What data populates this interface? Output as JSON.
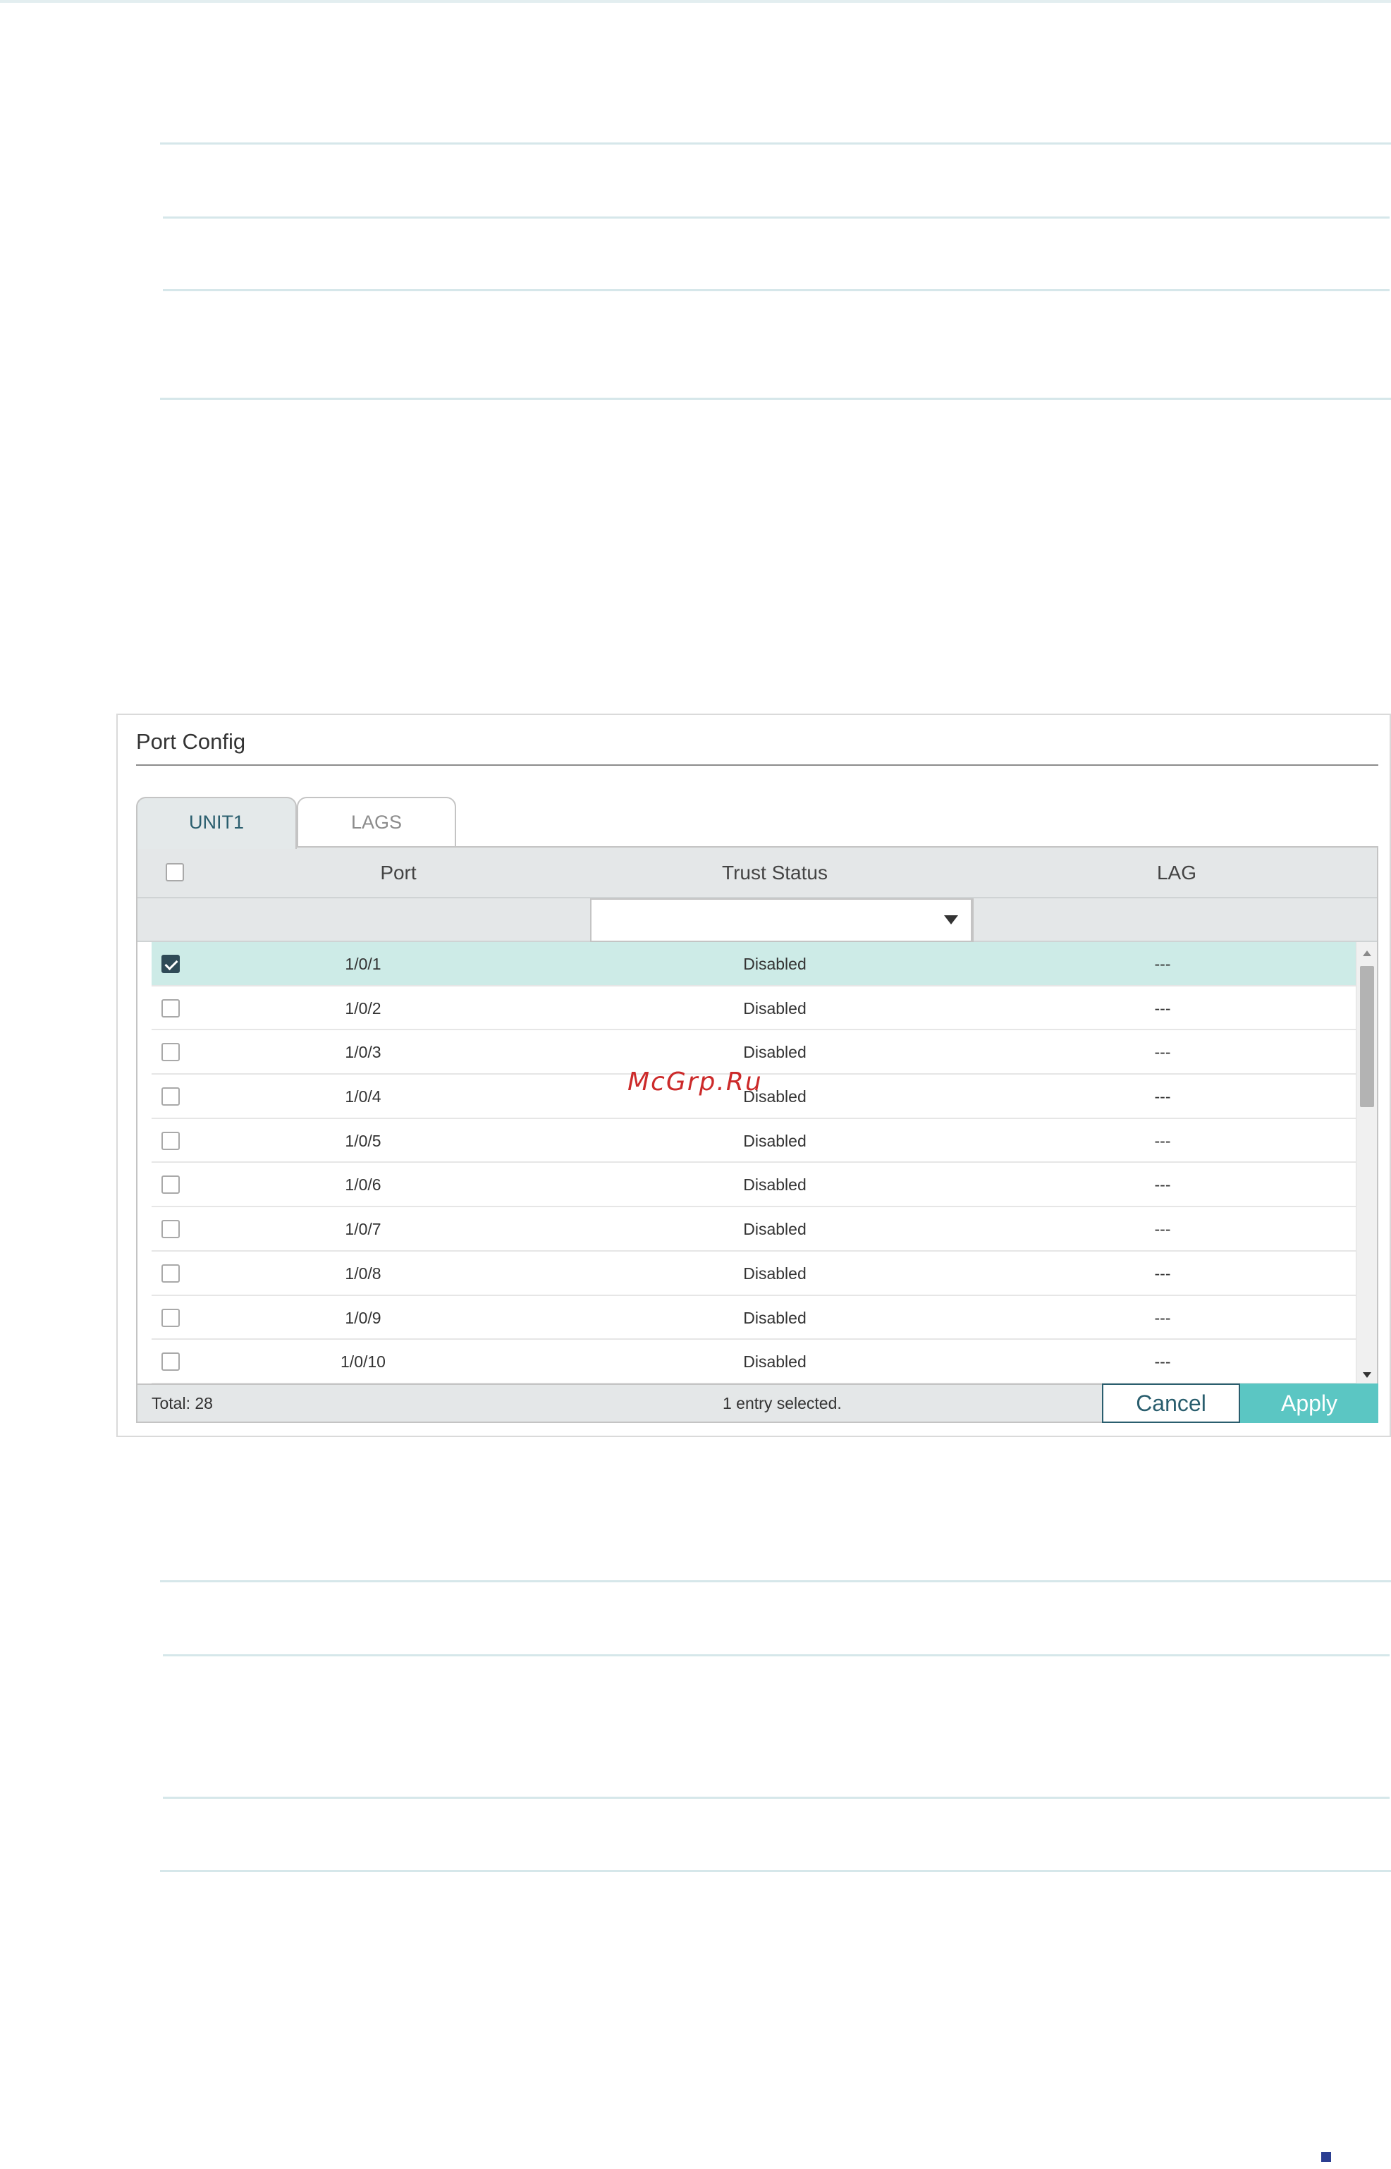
{
  "panel": {
    "title": "Port Config",
    "tabs": [
      {
        "label": "UNIT1",
        "active": true
      },
      {
        "label": "LAGS",
        "active": false
      }
    ],
    "columns": {
      "port": "Port",
      "trust_status": "Trust Status",
      "lag": "LAG"
    },
    "filter": {
      "trust_status_value": ""
    },
    "rows": [
      {
        "port": "1/0/1",
        "trust_status": "Disabled",
        "lag": "---",
        "checked": true
      },
      {
        "port": "1/0/2",
        "trust_status": "Disabled",
        "lag": "---",
        "checked": false
      },
      {
        "port": "1/0/3",
        "trust_status": "Disabled",
        "lag": "---",
        "checked": false
      },
      {
        "port": "1/0/4",
        "trust_status": "Disabled",
        "lag": "---",
        "checked": false
      },
      {
        "port": "1/0/5",
        "trust_status": "Disabled",
        "lag": "---",
        "checked": false
      },
      {
        "port": "1/0/6",
        "trust_status": "Disabled",
        "lag": "---",
        "checked": false
      },
      {
        "port": "1/0/7",
        "trust_status": "Disabled",
        "lag": "---",
        "checked": false
      },
      {
        "port": "1/0/8",
        "trust_status": "Disabled",
        "lag": "---",
        "checked": false
      },
      {
        "port": "1/0/9",
        "trust_status": "Disabled",
        "lag": "---",
        "checked": false
      },
      {
        "port": "1/0/10",
        "trust_status": "Disabled",
        "lag": "---",
        "checked": false
      }
    ],
    "footer": {
      "total": "Total: 28",
      "selected": "1 entry selected.",
      "cancel_label": "Cancel",
      "apply_label": "Apply"
    }
  },
  "watermark": "McGrp.Ru",
  "colors": {
    "accent": "#5bc6c3",
    "selected_row": "#cdebe7",
    "header_bg": "#e4e7e8",
    "dark_accent": "#2a5e6e",
    "checkbox_checked": "#2f4a57"
  },
  "icons": {
    "dropdown": "caret-down-icon",
    "checkbox": "checkbox-icon",
    "scroll_up": "arrow-up-icon",
    "scroll_down": "arrow-down-icon"
  }
}
